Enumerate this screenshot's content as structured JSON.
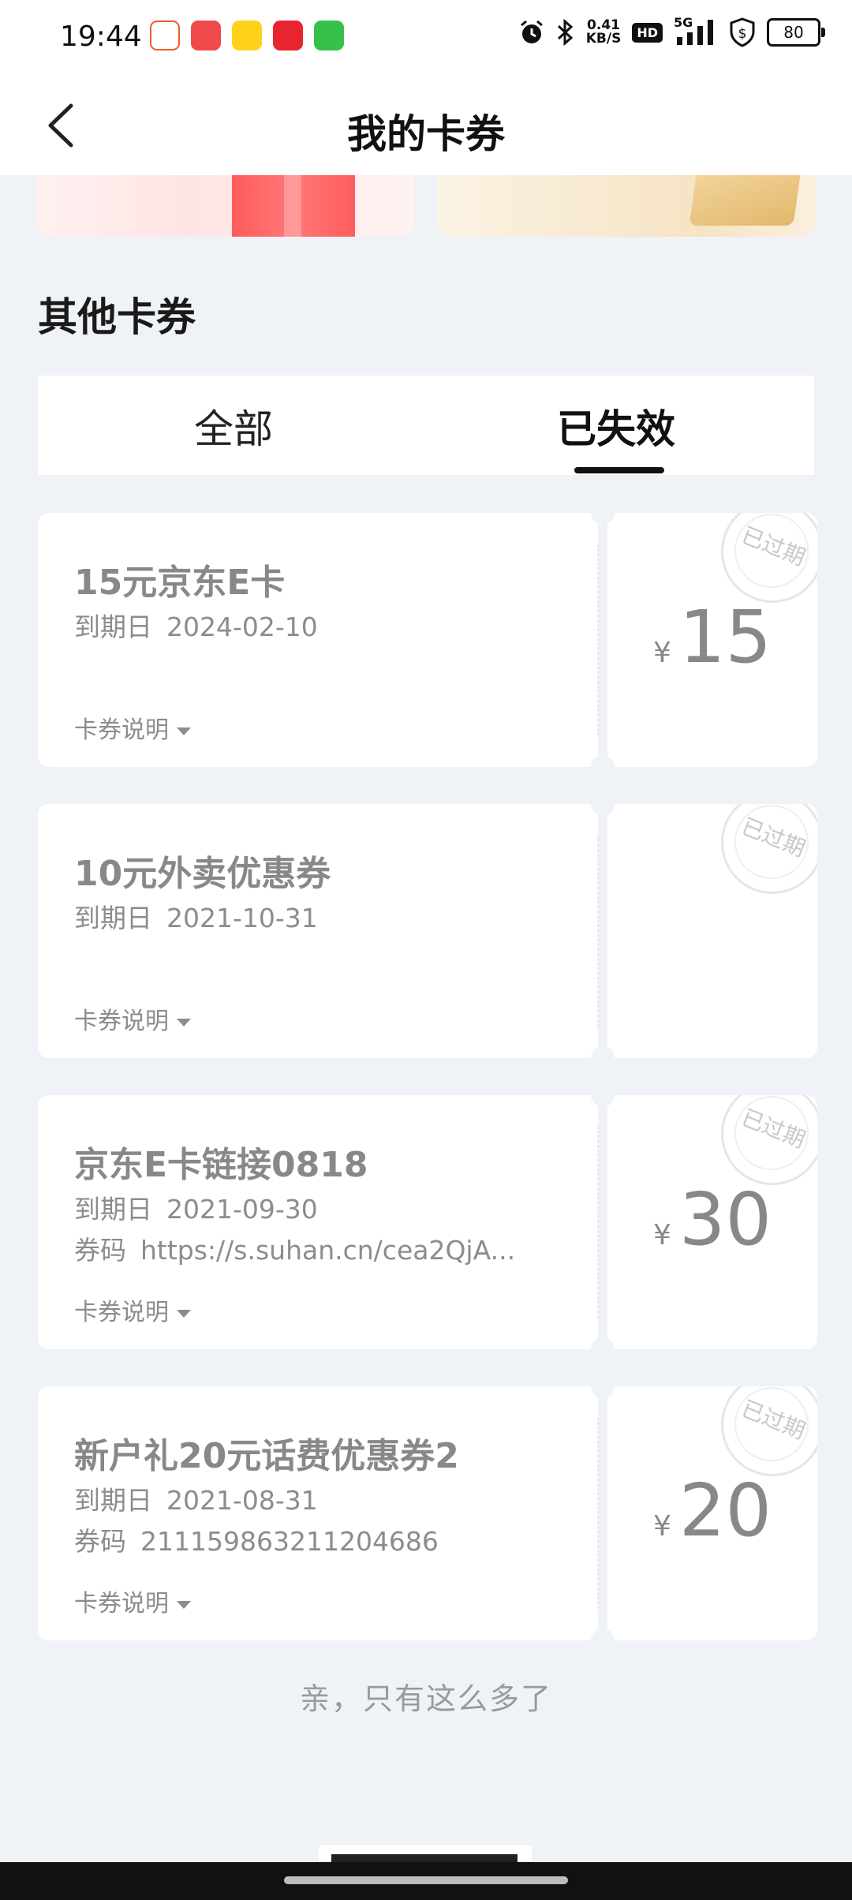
{
  "status_bar": {
    "time": "19:44",
    "net_speed_value": "0.41",
    "net_speed_unit": "KB/S",
    "hd_badge": "HD",
    "network_type": "5G",
    "battery": "80",
    "icons": [
      "58-app-icon",
      "game-app-icon",
      "weibo-icon",
      "music-app-icon",
      "message-app-icon",
      "alarm-icon",
      "bluetooth-icon",
      "signal-icon",
      "shield-dollar-icon"
    ]
  },
  "header": {
    "title": "我的卡券",
    "back_icon": "chevron-left-icon"
  },
  "section": {
    "title": "其他卡券"
  },
  "tabs": [
    {
      "label": "全部",
      "active": false
    },
    {
      "label": "已失效",
      "active": true
    }
  ],
  "coupons": [
    {
      "title": "15元京东E卡",
      "expiry_label": "到期日",
      "expiry": "2024-02-10",
      "code_label": "",
      "code": "",
      "desc": "卡券说明",
      "currency": "¥",
      "amount": "15",
      "stamp": "已过期"
    },
    {
      "title": "10元外卖优惠券",
      "expiry_label": "到期日",
      "expiry": "2021-10-31",
      "code_label": "",
      "code": "",
      "desc": "卡券说明",
      "currency": "",
      "amount": "",
      "stamp": "已过期"
    },
    {
      "title": "京东E卡链接0818",
      "expiry_label": "到期日",
      "expiry": "2021-09-30",
      "code_label": "券码",
      "code": "https://s.suhan.cn/cea2QjA...",
      "desc": "卡券说明",
      "currency": "¥",
      "amount": "30",
      "stamp": "已过期"
    },
    {
      "title": "新户礼20元话费优惠券2",
      "expiry_label": "到期日",
      "expiry": "2021-08-31",
      "code_label": "券码",
      "code": "211159863211204686",
      "desc": "卡券说明",
      "currency": "¥",
      "amount": "20",
      "stamp": "已过期"
    }
  ],
  "footer": {
    "end_text": "亲，只有这么多了"
  },
  "colors": {
    "page_bg": "#eff2f7",
    "card_bg": "#ffffff",
    "muted_text": "#8c8c8c"
  }
}
